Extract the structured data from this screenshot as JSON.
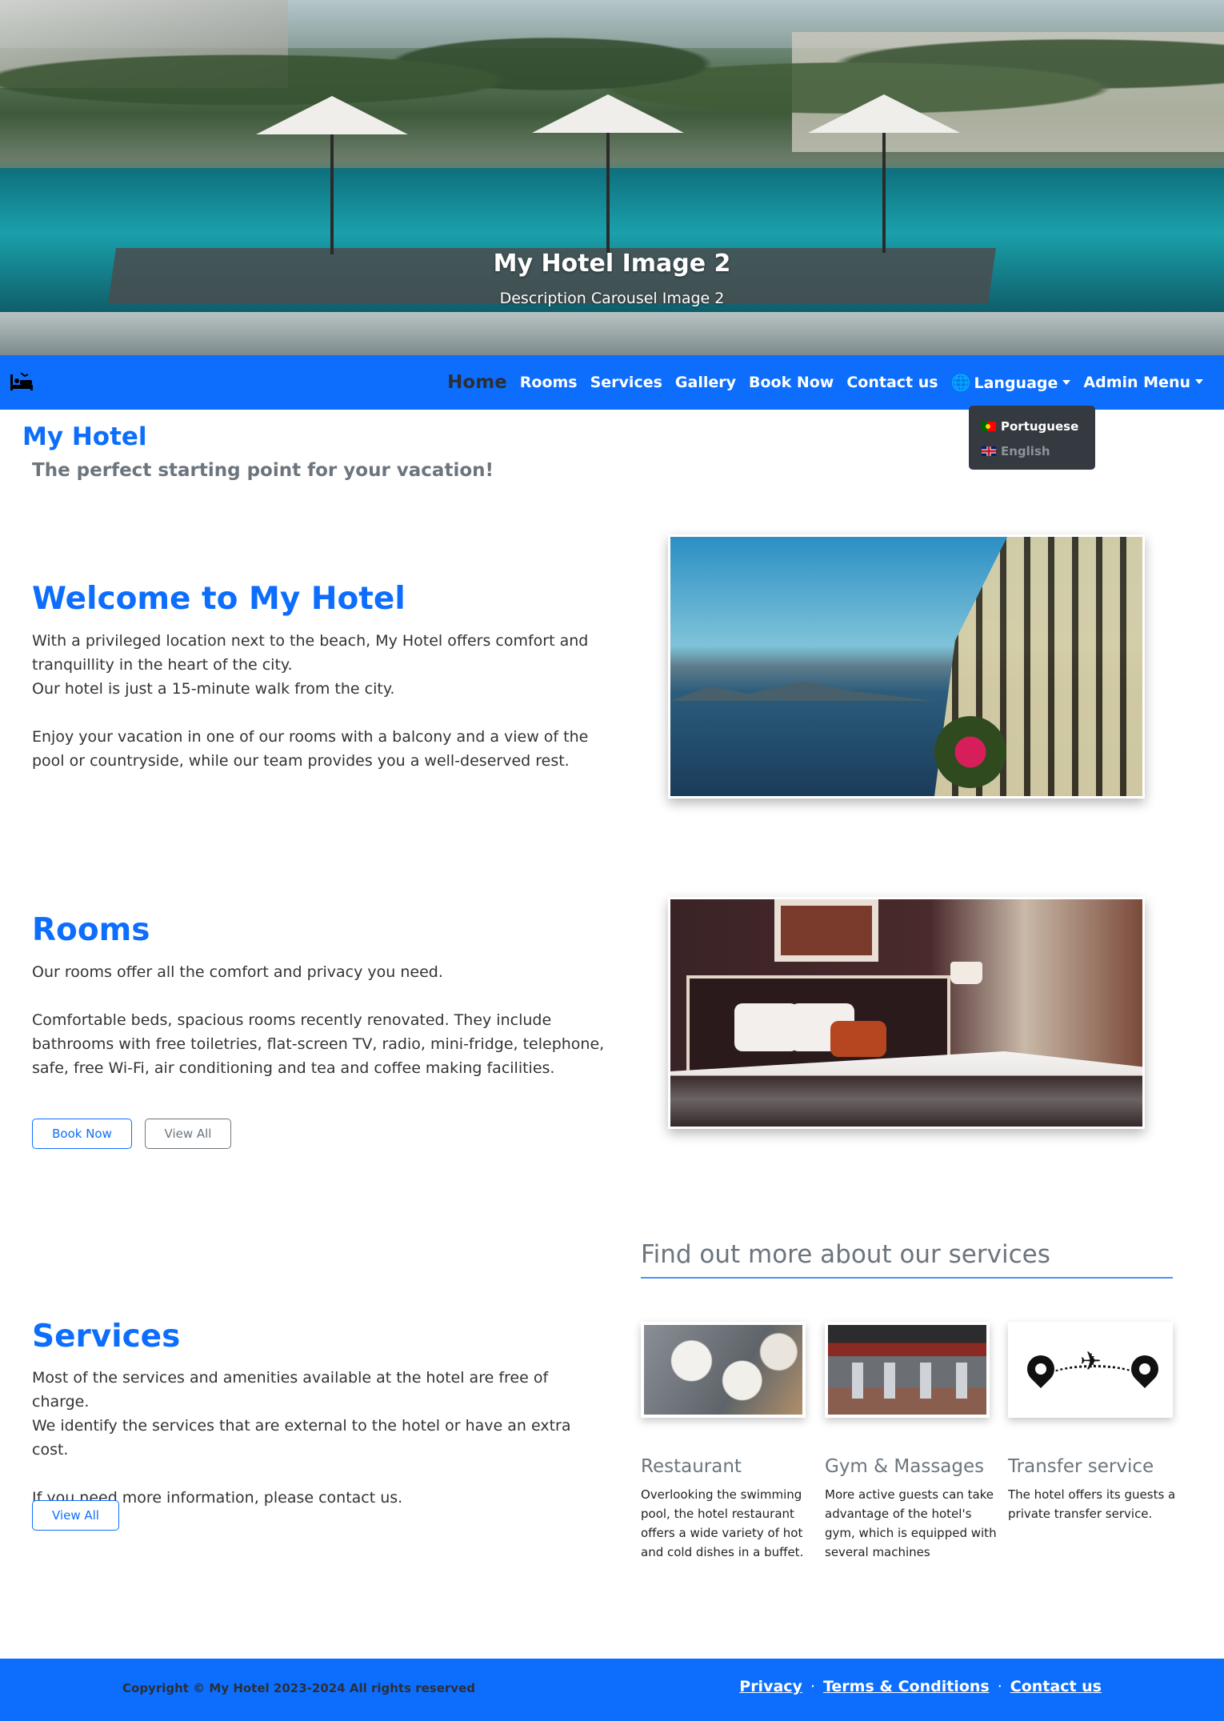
{
  "carousel": {
    "title": "My Hotel Image 2",
    "description": "Description Carousel Image 2"
  },
  "navbar": {
    "brand_icon": "hotel-bed-icon",
    "items": [
      {
        "label": "Home"
      },
      {
        "label": "Rooms"
      },
      {
        "label": "Services"
      },
      {
        "label": "Gallery"
      },
      {
        "label": "Book Now"
      },
      {
        "label": "Contact us"
      }
    ],
    "language_label": "Language",
    "language_icon": "globe-icon",
    "admin_label": "Admin Menu",
    "language_options": [
      {
        "label": "Portuguese",
        "icon": "flag-portugal-icon"
      },
      {
        "label": "English",
        "icon": "flag-uk-icon"
      }
    ]
  },
  "header": {
    "title": "My Hotel",
    "tagline": "The perfect starting point for your vacation!"
  },
  "welcome": {
    "title": "Welcome to My Hotel",
    "text": "With a privileged location next to the beach, My Hotel offers comfort and tranquillity in the heart of the city.\n Our hotel is just a 15-minute walk from the city.\n\n  Enjoy your vacation in one of our rooms with a balcony and a view of the pool or countryside, while our team provides you a well-deserved rest."
  },
  "rooms": {
    "title": "Rooms",
    "text": "Our rooms offer all the comfort and privacy you need.\n\n Comfortable beds, spacious rooms recently renovated. They include bathrooms with free toiletries, flat-screen TV, radio, mini-fridge, telephone, safe, free Wi-Fi, air conditioning and tea and coffee making facilities.",
    "book_label": "Book Now",
    "view_label": "View All"
  },
  "services": {
    "title": "Services",
    "text": "Most of the services and amenities available at the hotel are free of charge.\n We identify the services that are external to the hotel or have an extra cost.\n\nIf you need more information, please contact us.",
    "view_label": "View All",
    "more_heading": "Find out more about our services",
    "cards": [
      {
        "title": "Restaurant",
        "text": "Overlooking the swimming pool, the hotel restaurant offers a wide variety of hot and cold dishes in a buffet."
      },
      {
        "title": "Gym & Massages",
        "text": "More active guests can take advantage of the hotel's gym, which is equipped with several machines"
      },
      {
        "title": "Transfer service",
        "text": "The hotel offers its guests a private transfer service."
      }
    ]
  },
  "footer": {
    "copyright": "Copyright © My Hotel 2023-2024 All rights reserved",
    "links": [
      {
        "label": "Privacy"
      },
      {
        "label": "Terms & Conditions"
      },
      {
        "label": "Contact us"
      }
    ],
    "separator": "·"
  },
  "colors": {
    "primary": "#0d6efd",
    "secondary": "#6c757d",
    "dropdown_bg": "#343a40"
  }
}
